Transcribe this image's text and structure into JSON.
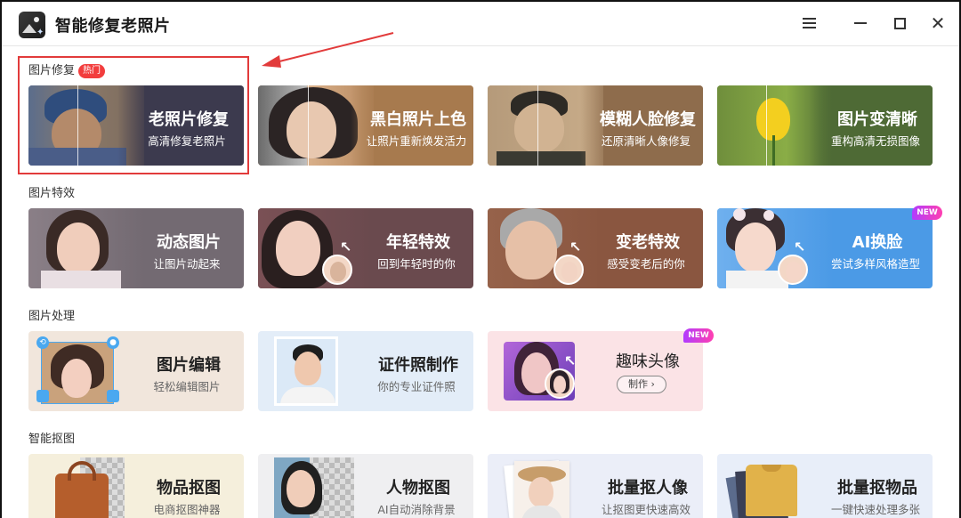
{
  "app": {
    "title": "智能修复老照片"
  },
  "sections": {
    "repair": {
      "label": "图片修复",
      "badge": "热门"
    },
    "effects": {
      "label": "图片特效"
    },
    "process": {
      "label": "图片处理"
    },
    "cutout": {
      "label": "智能抠图"
    }
  },
  "cards": {
    "old_photo": {
      "title": "老照片修复",
      "sub": "高清修复老照片"
    },
    "colorize": {
      "title": "黑白照片上色",
      "sub": "让照片重新焕发活力"
    },
    "blur_face": {
      "title": "模糊人脸修复",
      "sub": "还原清晰人像修复"
    },
    "sharpen": {
      "title": "图片变清晰",
      "sub": "重构高清无损图像"
    },
    "animate": {
      "title": "动态图片",
      "sub": "让图片动起来"
    },
    "younger": {
      "title": "年轻特效",
      "sub": "回到年轻时的你"
    },
    "older": {
      "title": "变老特效",
      "sub": "感受变老后的你"
    },
    "face_swap": {
      "title": "AI换脸",
      "sub": "尝试多样风格造型",
      "badge": "NEW"
    },
    "edit": {
      "title": "图片编辑",
      "sub": "轻松编辑图片"
    },
    "id_photo": {
      "title": "证件照制作",
      "sub": "你的专业证件照"
    },
    "avatar": {
      "title": "趣味头像",
      "button": "制作",
      "badge": "NEW"
    },
    "product_cut": {
      "title": "物品抠图",
      "sub": "电商抠图神器"
    },
    "person_cut": {
      "title": "人物抠图",
      "sub": "AI自动消除背景"
    },
    "batch_person": {
      "title": "批量抠人像",
      "sub": "让抠图更快速高效"
    },
    "batch_product": {
      "title": "批量抠物品",
      "sub": "一键快速处理多张"
    }
  },
  "colors": {
    "accent_red": "#e23b3b",
    "new_badge": "#c93cff"
  }
}
